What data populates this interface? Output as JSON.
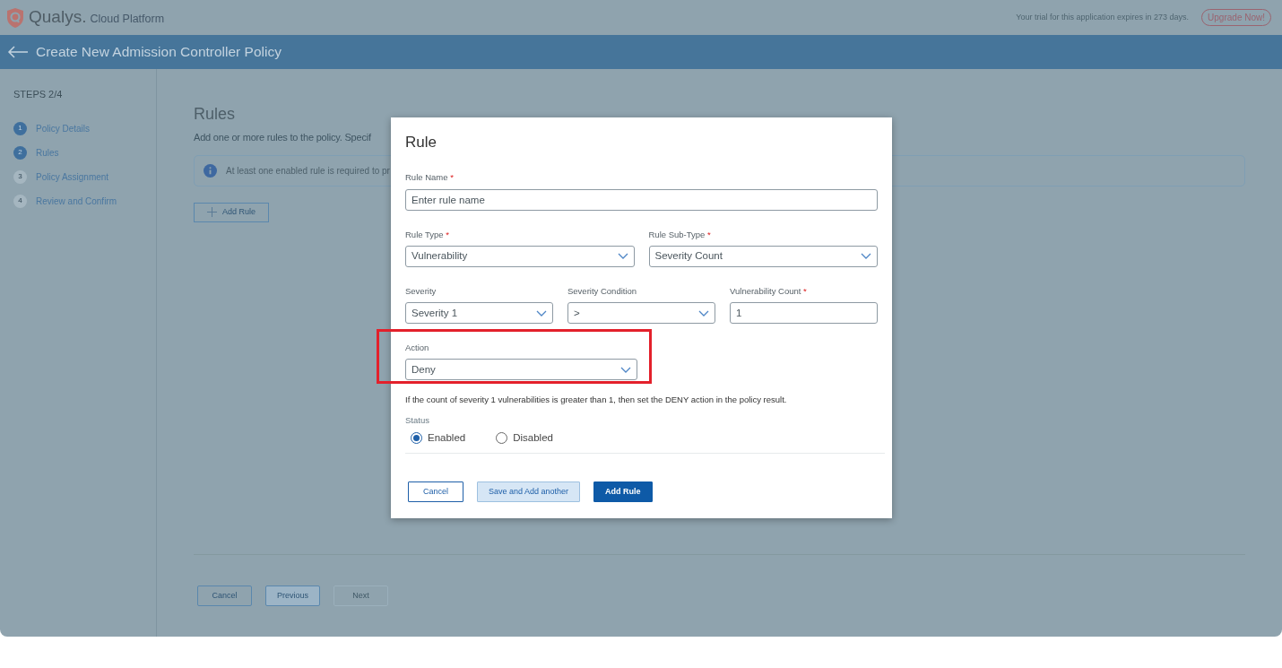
{
  "topbar": {
    "brand": "Qualys.",
    "product": "Cloud Platform",
    "trial_notice": "Your trial for this application expires in 273 days.",
    "upgrade_button": "Upgrade Now!"
  },
  "header": {
    "title": "Create New Admission Controller Policy"
  },
  "sidebar": {
    "steps_label": "STEPS 2/4",
    "steps": [
      {
        "number": "1",
        "label": "Policy Details",
        "active": true
      },
      {
        "number": "2",
        "label": "Rules",
        "active": true
      },
      {
        "number": "3",
        "label": "Policy Assignment",
        "active": false
      },
      {
        "number": "4",
        "label": "Review and Confirm",
        "active": false
      }
    ]
  },
  "main": {
    "title": "Rules",
    "subtitle": "Add one or more rules to the policy. Specif",
    "info": "At least one enabled rule is required to pr",
    "add_rule_button": "Add Rule",
    "footer_buttons": [
      {
        "label": "Cancel",
        "kind": "outline",
        "disabled": false
      },
      {
        "label": "Previous",
        "kind": "light",
        "disabled": false
      },
      {
        "label": "Next",
        "kind": "outline",
        "disabled": true
      }
    ]
  },
  "dialog": {
    "title": "Rule",
    "rows": [
      [
        {
          "label": "Rule Name",
          "required_mark": "*",
          "kind": "input",
          "placeholder": "Enter rule name"
        }
      ],
      [
        {
          "label": "Rule Type",
          "required_mark": "*",
          "kind": "select",
          "value": "Vulnerability"
        },
        {
          "label": "Rule Sub-Type",
          "required_mark": "*",
          "kind": "select",
          "value": "Severity Count"
        }
      ],
      [
        {
          "label": "Severity",
          "kind": "select",
          "value": "Severity 1"
        },
        {
          "label": "Severity Condition",
          "kind": "select",
          "value": ">"
        },
        {
          "label": "Vulnerability Count",
          "required_mark": "*",
          "kind": "input",
          "value": "1"
        }
      ],
      [
        {
          "label": "Action",
          "kind": "select",
          "value": "Deny",
          "highlighted": true
        }
      ]
    ],
    "summary": "If the count of severity 1 vulnerabilities is greater than 1, then set the DENY action in the policy result.",
    "status_label": "Status",
    "status_options": [
      {
        "label": "Enabled",
        "selected": true
      },
      {
        "label": "Disabled",
        "selected": false
      }
    ],
    "buttons": [
      {
        "label": "Cancel",
        "kind": "outline"
      },
      {
        "label": "Save and Add another",
        "kind": "light"
      },
      {
        "label": "Add Rule",
        "kind": "primary"
      }
    ]
  }
}
